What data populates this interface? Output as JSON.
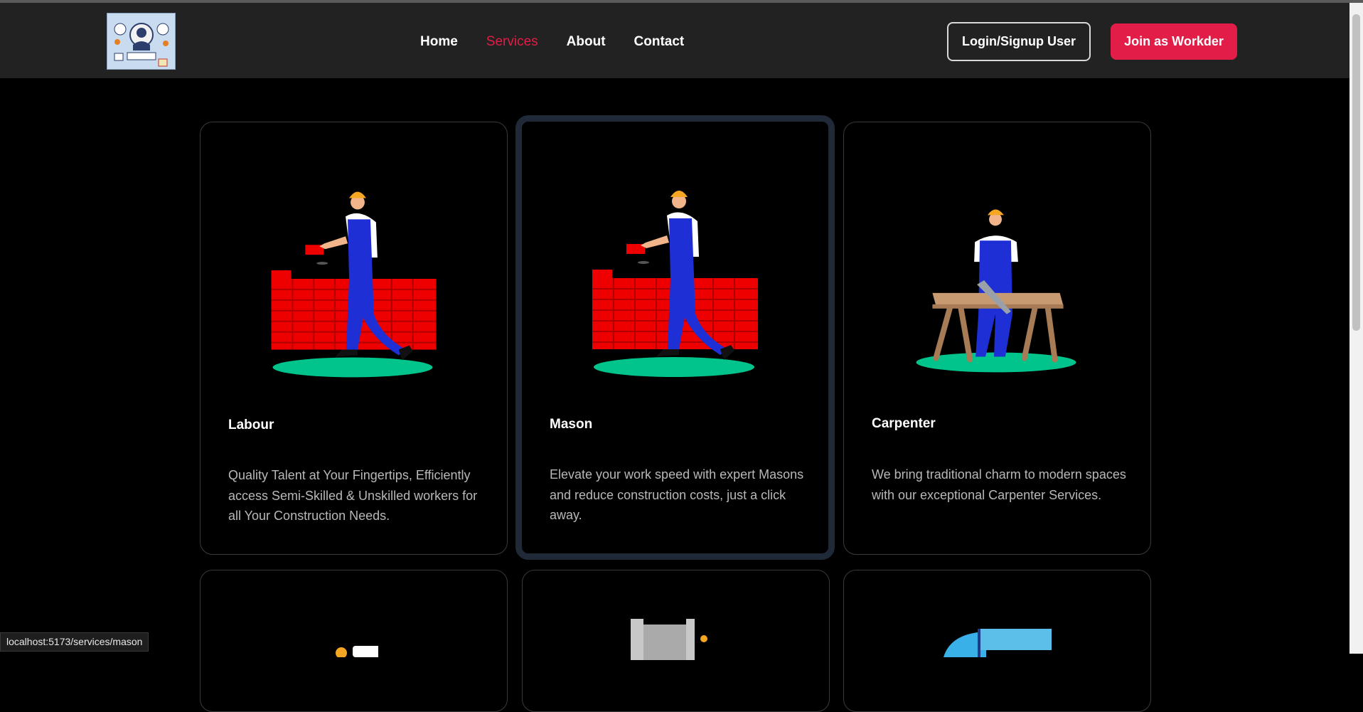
{
  "nav": {
    "items": [
      {
        "label": "Home",
        "active": false
      },
      {
        "label": "Services",
        "active": true
      },
      {
        "label": "About",
        "active": false
      },
      {
        "label": "Contact",
        "active": false
      }
    ]
  },
  "buttons": {
    "login": "Login/Signup User",
    "join": "Join as Workder"
  },
  "services": [
    {
      "title": "Labour",
      "description": "Quality Talent at Your Fingertips, Efficiently access Semi-Skilled & Unskilled workers for all Your Construction Needs."
    },
    {
      "title": "Mason",
      "description": "Elevate your work speed with expert Masons and reduce construction costs, just a click away."
    },
    {
      "title": "Carpenter",
      "description": "We bring traditional charm to modern spaces with our exceptional Carpenter Services."
    }
  ],
  "status_url": "localhost:5173/services/mason",
  "colors": {
    "accent": "#e11d48",
    "header_bg": "#222222",
    "page_bg": "#000000"
  }
}
